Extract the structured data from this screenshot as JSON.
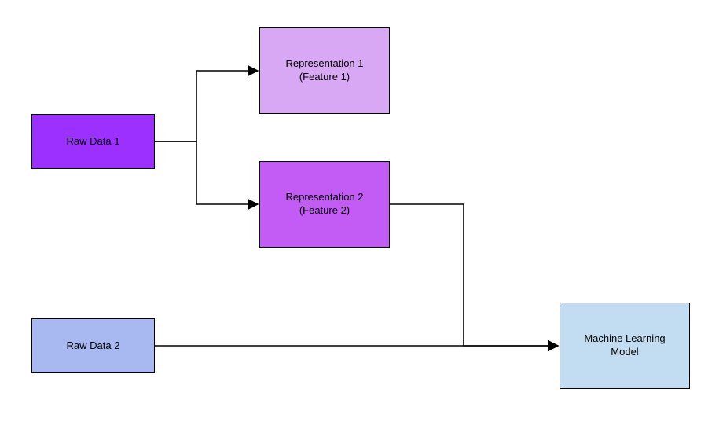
{
  "nodes": {
    "raw1": {
      "label": "Raw Data 1",
      "fill": "#9b30ff"
    },
    "raw2": {
      "label": "Raw Data 2",
      "fill": "#a8b8f0"
    },
    "rep1": {
      "label_line1": "Representation 1",
      "label_line2": "(Feature 1)",
      "fill": "#d9a8f5"
    },
    "rep2": {
      "label_line1": "Representation 2",
      "label_line2": "(Feature 2)",
      "fill": "#c25cf5"
    },
    "ml": {
      "label_line1": "Machine Learning",
      "label_line2": "Model",
      "fill": "#c2ddf2"
    }
  }
}
